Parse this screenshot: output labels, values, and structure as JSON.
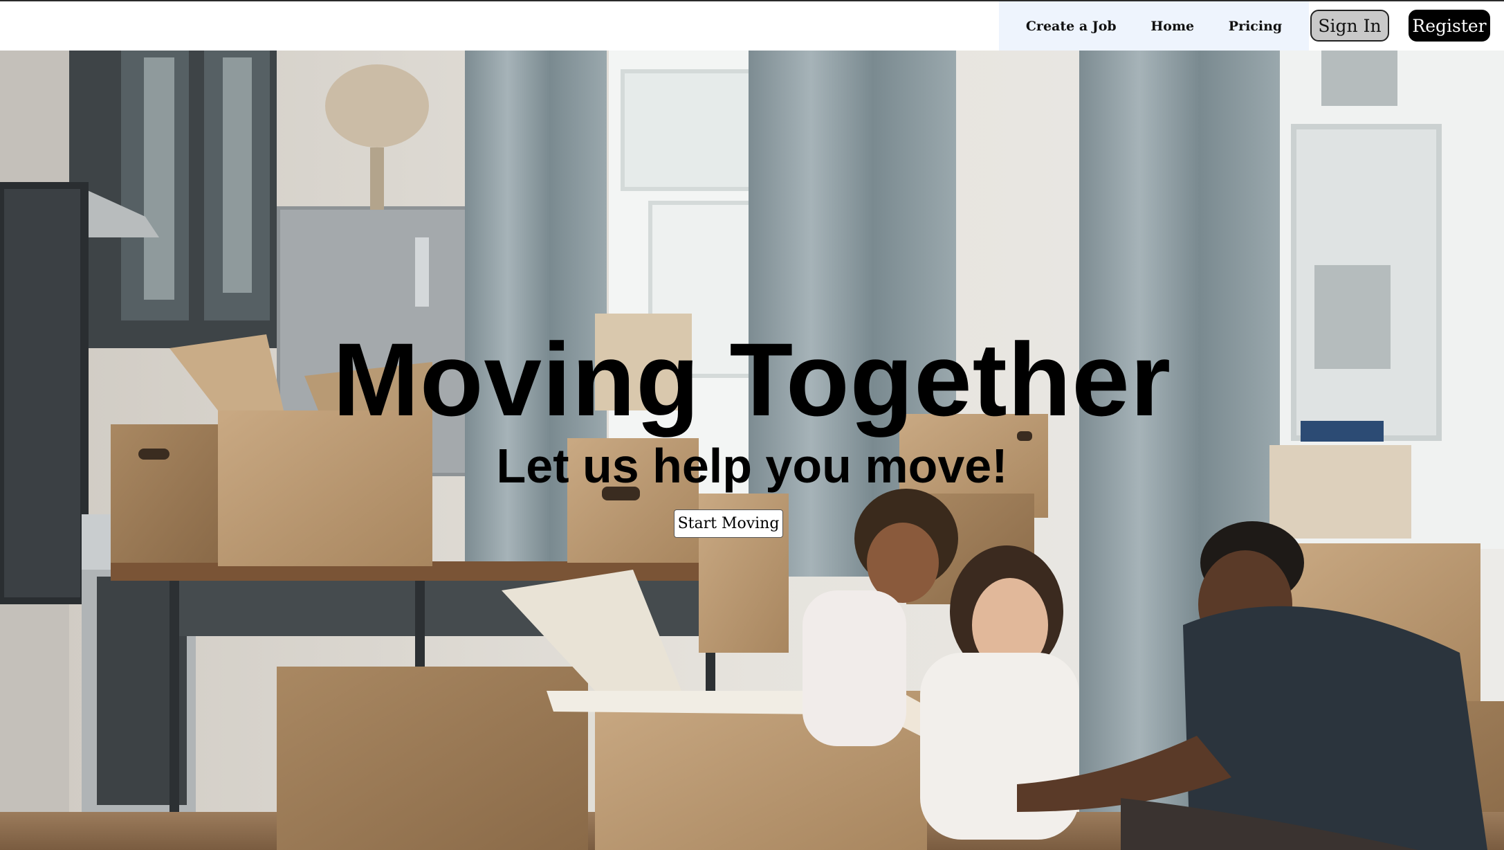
{
  "nav": {
    "links": [
      {
        "label": "Create a Job"
      },
      {
        "label": "Home"
      },
      {
        "label": "Pricing"
      }
    ],
    "sign_in_label": "Sign In",
    "register_label": "Register"
  },
  "hero": {
    "image_description_icon": "moving-family-photo",
    "title": "Moving Together",
    "subtitle": "Let us help you move!",
    "cta_label": "Start Moving"
  },
  "colors": {
    "nav_links_bg": "#eef4fd",
    "signin_bg": "#c9c9c9",
    "register_bg": "#000000",
    "text": "#000000"
  }
}
